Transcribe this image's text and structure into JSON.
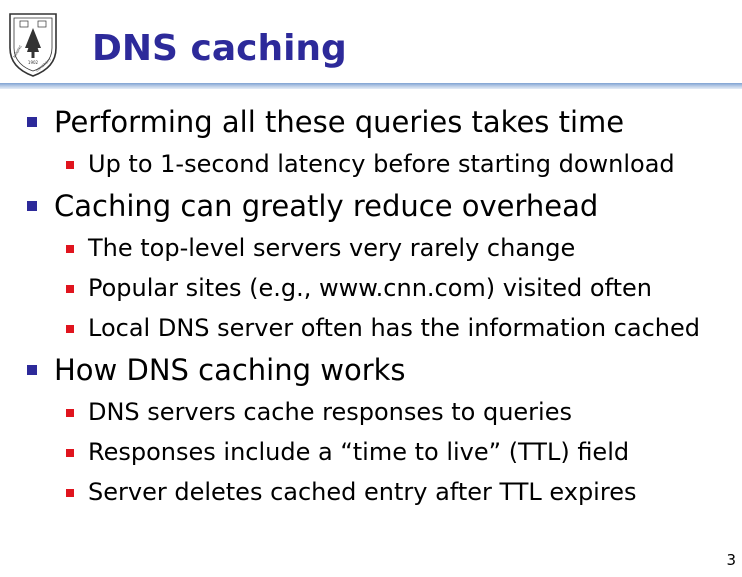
{
  "slide": {
    "title": "DNS caching",
    "page_number": "3",
    "logo": {
      "alt_text": "1902 NANJING UNIVERSITY",
      "year": "1902",
      "name_left": "NANJING",
      "name_right": "UNIVERSITY"
    },
    "bullets": [
      {
        "text": "Performing all these queries takes time",
        "sub": [
          "Up to 1-second latency before starting download"
        ]
      },
      {
        "text": "Caching can greatly reduce overhead",
        "sub": [
          "The top-level servers very rarely change",
          "Popular sites (e.g., www.cnn.com) visited often",
          "Local DNS server often has the information cached"
        ]
      },
      {
        "text": "How DNS caching works",
        "sub": [
          "DNS servers cache responses to queries",
          "Responses include a  “time to live”  (TTL) field",
          "Server deletes cached entry after TTL expires"
        ]
      }
    ]
  },
  "colors": {
    "title": "#2d2a9a",
    "level1_bullet": "#2d2a9a",
    "level2_bullet": "#e0141e",
    "rule": "#7fa2d3"
  }
}
